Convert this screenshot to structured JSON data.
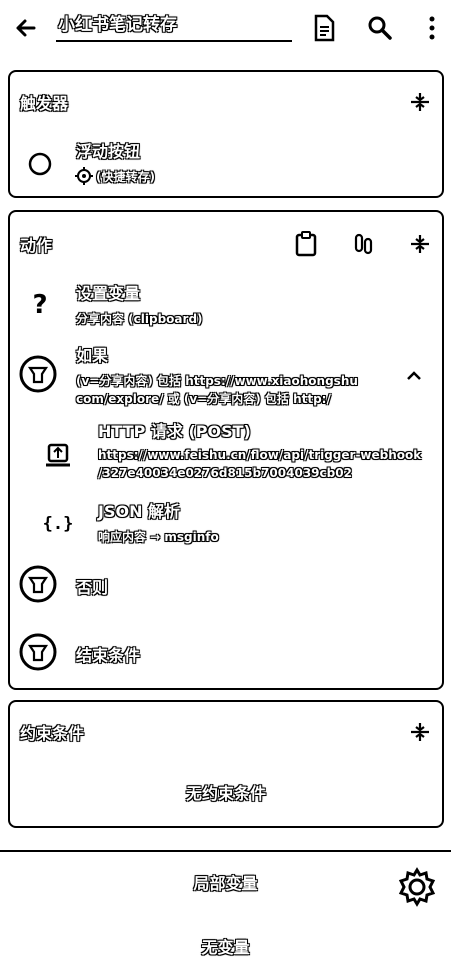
{
  "toolbar": {
    "title": "小红书笔记转存"
  },
  "trigger": {
    "title": "触发器",
    "item_label": "浮动按钮",
    "item_sub": "(快捷转存)"
  },
  "actions": {
    "title": "动作",
    "items": [
      {
        "label": "设置变量",
        "sub": "分享内容 (clipboard)"
      },
      {
        "label": "如果",
        "sub1": "(v=分享内容) 包括 https://www.xiaohongshu",
        "sub2": "com/explore/ 或 (v=分享内容) 包括 http:/"
      },
      {
        "label": "HTTP 请求 (POST)",
        "sub1": "https://www.feishu.cn/flow/api/trigger-webhook",
        "sub2": "/327e40034e0276d815b7004039cb02"
      },
      {
        "label": "JSON 解析",
        "sub": "响应内容 → msginfo"
      },
      {
        "label": "否则"
      },
      {
        "label": "结束条件"
      }
    ]
  },
  "constraints": {
    "title": "约束条件",
    "empty": "无约束条件"
  },
  "local_vars": {
    "title": "局部变量",
    "empty": "无变量"
  }
}
